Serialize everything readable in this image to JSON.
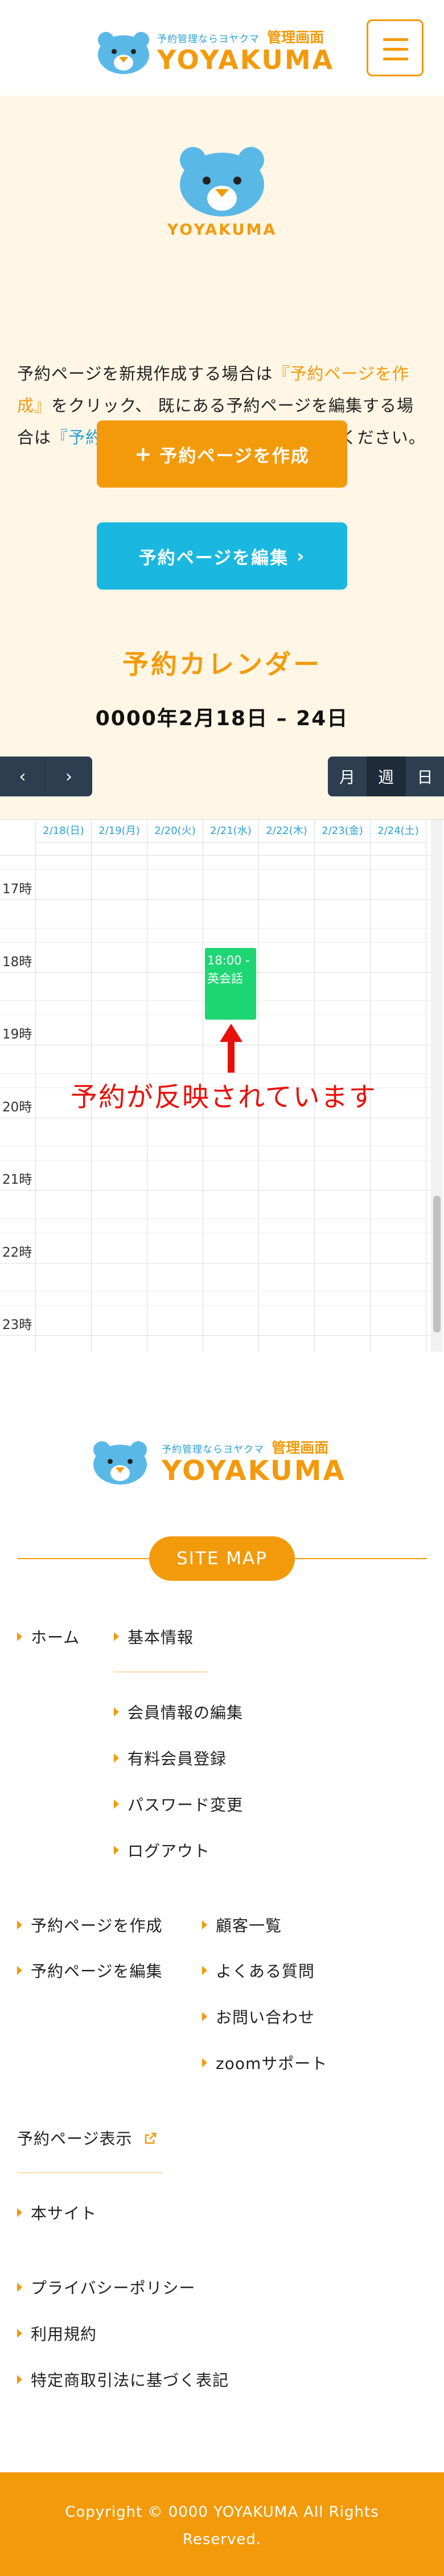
{
  "header": {
    "logo_sub": "予約管理ならヨヤクマ",
    "logo_admin": "管理画面",
    "logo_word": "YOYAKUMA"
  },
  "intro": {
    "logo_word": "YOYAKUMA",
    "text_1": "予約ページを新規作成する場合は",
    "text_2": "『予約ページを作成』",
    "text_3": "をクリック、 既にある予約ページを編集する場合は",
    "text_4": "『予約ページを編集』",
    "text_5": "をクリックしてください。",
    "create_label": "予約ページを作成",
    "edit_label": "予約ページを編集"
  },
  "calendar": {
    "title": "予約カレンダー",
    "range": "0000年2月18日 – 24日",
    "prev_icon": "chevron-left-icon",
    "next_icon": "chevron-right-icon",
    "view_month": "月",
    "view_week": "週",
    "view_day": "日",
    "active_view": "週",
    "days": [
      "2/18(日)",
      "2/19(月)",
      "2/20(火)",
      "2/21(水)",
      "2/22(木)",
      "2/23(金)",
      "2/24(土)"
    ],
    "hours": [
      "17時",
      "18時",
      "19時",
      "20時",
      "21時",
      "22時",
      "23時"
    ],
    "event": {
      "time": "18:00 -",
      "title": "英会話"
    },
    "annotation": "予約が反映されています"
  },
  "footer": {
    "logo_sub": "予約管理ならヨヤクマ",
    "logo_admin": "管理画面",
    "logo_word": "YOYAKUMA",
    "sitemap": "SITE MAP",
    "home": "ホーム",
    "basic_info": "基本情報",
    "member_edit": "会員情報の編集",
    "paid_member": "有料会員登録",
    "password_change": "パスワード変更",
    "logout": "ログアウト",
    "create_page": "予約ページを作成",
    "edit_page": "予約ページを編集",
    "customers": "顧客一覧",
    "faq": "よくある質問",
    "contact": "お問い合わせ",
    "zoom_support": "zoomサポート",
    "view_page": "予約ページ表示",
    "main_site": "本サイト",
    "privacy": "プライバシーポリシー",
    "terms": "利用規約",
    "tokushoho": "特定商取引法に基づく表記",
    "copyright": "Copyright © 0000 YOYAKUMA All Rights Reserved."
  },
  "colors": {
    "orange": "#f39a0b",
    "cyan": "#1ab8e0",
    "navy": "#2c3e50",
    "event_green": "#1fd674",
    "annotation_red": "#e8100a"
  }
}
